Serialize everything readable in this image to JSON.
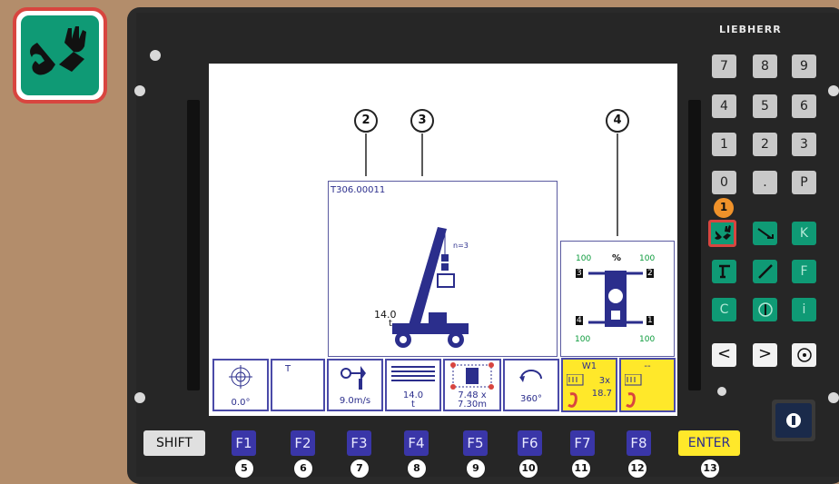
{
  "brand": "LIEBHERR",
  "colors": {
    "background": "#b38d6b",
    "panel": "#262626",
    "green_key": "#0f9a75",
    "highlight": "#d8453f",
    "fkey_blue": "#3a36a8",
    "enter_yellow": "#ffe82a"
  },
  "screen": {
    "main_title": "T306.00011",
    "hook_label": "n=3",
    "load_value": "14.0",
    "load_unit": "t",
    "outrigger": {
      "header_left": "100",
      "header_mid": "%",
      "header_right": "100",
      "label_3": "3",
      "label_2": "2",
      "label_4": "4",
      "label_1": "1",
      "bottom_left": "100",
      "bottom_right": "100"
    },
    "fkeys": [
      {
        "id": "f1",
        "text": "0.0°",
        "icon": "target-icon"
      },
      {
        "id": "f2",
        "text": "T",
        "icon": ""
      },
      {
        "id": "f3",
        "text": "9.0m/s",
        "icon": "wind-icon"
      },
      {
        "id": "f4",
        "text": "14.0",
        "text2": "t",
        "icon": "counterweight-icon"
      },
      {
        "id": "f5",
        "text": "7.48 x",
        "text2": "7.30m",
        "icon": "outrigger-icon"
      },
      {
        "id": "f6",
        "text": "360°",
        "icon": "slew-icon"
      },
      {
        "id": "f7",
        "title": "W1",
        "value1": "3x",
        "value2": "18.7",
        "icon": "winch-icon"
      },
      {
        "id": "f8",
        "title": "--",
        "icon": "winch-icon"
      }
    ]
  },
  "callouts": {
    "c1": "1",
    "c2": "2",
    "c3": "3",
    "c4": "4"
  },
  "keypad": {
    "row1": [
      "7",
      "8",
      "9"
    ],
    "row2": [
      "4",
      "5",
      "6"
    ],
    "row3": [
      "1",
      "2",
      "3"
    ],
    "row4": [
      "0",
      ".",
      "P"
    ],
    "k_label": "K",
    "f_label": "F",
    "c_label": "C",
    "i_label": "i",
    "left": "<",
    "right": ">"
  },
  "bottom": {
    "shift": "SHIFT",
    "f": [
      "F1",
      "F2",
      "F3",
      "F4",
      "F5",
      "F6",
      "F7",
      "F8"
    ],
    "enter": "ENTER",
    "nums": [
      "5",
      "6",
      "7",
      "8",
      "9",
      "10",
      "11",
      "12",
      "13"
    ]
  }
}
